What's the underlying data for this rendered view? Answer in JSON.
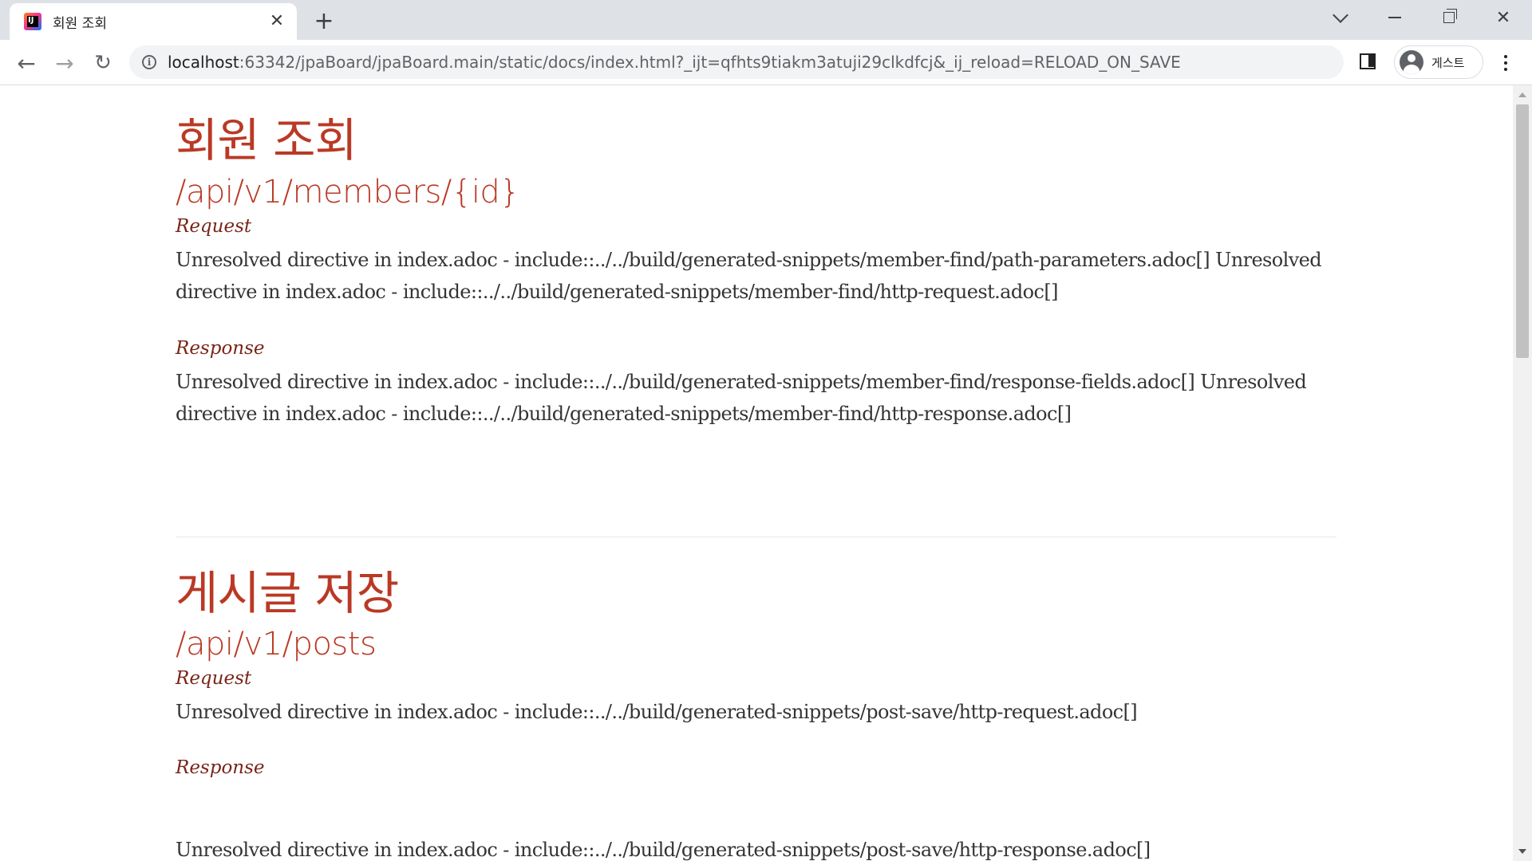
{
  "browser": {
    "tab": {
      "title": "회원 조회"
    },
    "new_tab": "+",
    "close_tab": "✕",
    "address": {
      "host": "localhost",
      "rest": ":63342/jpaBoard/jpaBoard.main/static/docs/index.html?_ijt=qfhts9tiakm3atuji29clkdfcj&_ij_reload=RELOAD_ON_SAVE"
    },
    "profile_label": "게스트",
    "nav": {
      "back": "←",
      "forward": "→",
      "reload": "↻"
    },
    "window_controls": {
      "close": "✕"
    }
  },
  "sections": [
    {
      "heading": "회원 조회",
      "endpoint": "/api/v1/members/{id}",
      "request_label": "Request",
      "request_text": "Unresolved directive in index.adoc - include::../../build/generated-snippets/member-find/path-parameters.adoc[] Unresolved directive in index.adoc - include::../../build/generated-snippets/member-find/http-request.adoc[]",
      "response_label": "Response",
      "response_text": "Unresolved directive in index.adoc - include::../../build/generated-snippets/member-find/response-fields.adoc[] Unresolved directive in index.adoc - include::../../build/generated-snippets/member-find/http-response.adoc[]"
    },
    {
      "heading": "게시글 저장",
      "endpoint": "/api/v1/posts",
      "request_label": "Request",
      "request_text": "Unresolved directive in index.adoc - include::../../build/generated-snippets/post-save/http-request.adoc[]",
      "response_label": "Response",
      "response_text": "Unresolved directive in index.adoc - include::../../build/generated-snippets/post-save/http-response.adoc[]"
    }
  ],
  "colors": {
    "heading": "#ba3925",
    "label": "#7a2518",
    "body_text": "#333333"
  },
  "icons": {
    "favicon": "intellij-icon",
    "site_info": "info-icon",
    "side_panel": "side-panel-icon",
    "avatar": "account-icon",
    "menu": "more-vert-icon"
  }
}
